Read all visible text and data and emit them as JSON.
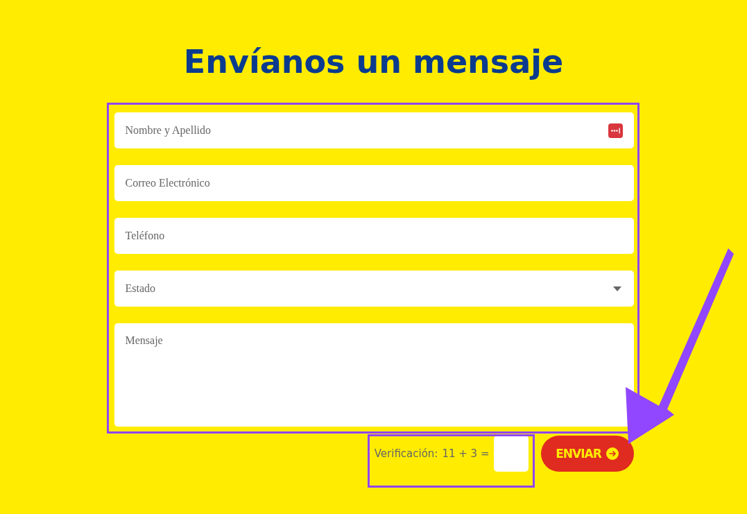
{
  "title": "Envíanos un mensaje",
  "fields": [
    {
      "kind": "text",
      "placeholder": "Nombre y Apellido",
      "autofill_icon": true
    },
    {
      "kind": "text",
      "placeholder": "Correo Electrónico",
      "autofill_icon": false
    },
    {
      "kind": "text",
      "placeholder": "Teléfono",
      "autofill_icon": false
    },
    {
      "kind": "select",
      "placeholder": "Estado",
      "autofill_icon": false
    },
    {
      "kind": "textarea",
      "placeholder": "Mensaje",
      "autofill_icon": false
    }
  ],
  "verification": {
    "label": "Verificación:",
    "question": "11 + 3 ="
  },
  "submit": {
    "label": "ENVIAR"
  }
}
